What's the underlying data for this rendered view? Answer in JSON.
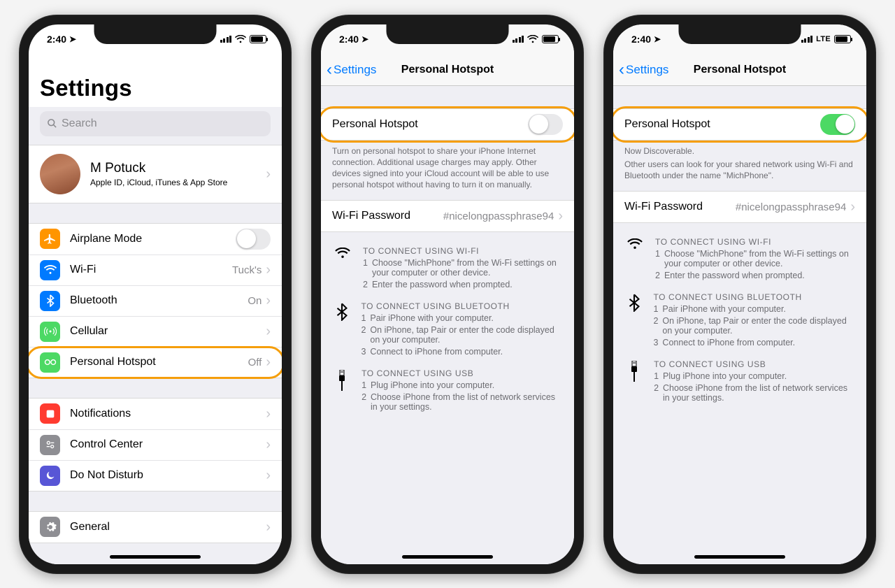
{
  "status": {
    "time": "2:40",
    "lte": "LTE"
  },
  "screen1": {
    "title": "Settings",
    "search_placeholder": "Search",
    "profile_name": "M Potuck",
    "profile_sub": "Apple ID, iCloud, iTunes & App Store",
    "rows": {
      "airplane": "Airplane Mode",
      "wifi": "Wi-Fi",
      "wifi_val": "Tuck's",
      "bt": "Bluetooth",
      "bt_val": "On",
      "cell": "Cellular",
      "ph": "Personal Hotspot",
      "ph_val": "Off",
      "notif": "Notifications",
      "cc": "Control Center",
      "dnd": "Do Not Disturb",
      "gen": "General"
    }
  },
  "hotspot": {
    "back": "Settings",
    "title": "Personal Hotspot",
    "toggle_label": "Personal Hotspot",
    "off_note": "Turn on personal hotspot to share your iPhone Internet connection. Additional usage charges may apply. Other devices signed into your iCloud account will be able to use personal hotspot without having to turn it on manually.",
    "on_note1": "Now Discoverable.",
    "on_note2": "Other users can look for your shared network using Wi-Fi and Bluetooth under the name \"MichPhone\".",
    "wifi_pw_label": "Wi-Fi Password",
    "wifi_pw_value": "#nicelongpassphrase94",
    "sec_wifi_title": "TO CONNECT USING WI-FI",
    "sec_wifi_1": "Choose \"MichPhone\" from the Wi-Fi settings on your computer or other device.",
    "sec_wifi_2": "Enter the password when prompted.",
    "sec_bt_title": "TO CONNECT USING BLUETOOTH",
    "sec_bt_1": "Pair iPhone with your computer.",
    "sec_bt_2": "On iPhone, tap Pair or enter the code displayed on your computer.",
    "sec_bt_3": "Connect to iPhone from computer.",
    "sec_usb_title": "TO CONNECT USING USB",
    "sec_usb_1": "Plug iPhone into your computer.",
    "sec_usb_2": "Choose iPhone from the list of network services in your settings."
  },
  "colors": {
    "orange": "#f59e0b",
    "blue": "#007aff",
    "green_toggle": "#4cd964",
    "icon_orange": "#ff9500",
    "icon_blue": "#007aff",
    "icon_green": "#4cd964",
    "icon_red": "#ff3b30",
    "icon_gray": "#8e8e93",
    "icon_purple": "#5856d6"
  }
}
